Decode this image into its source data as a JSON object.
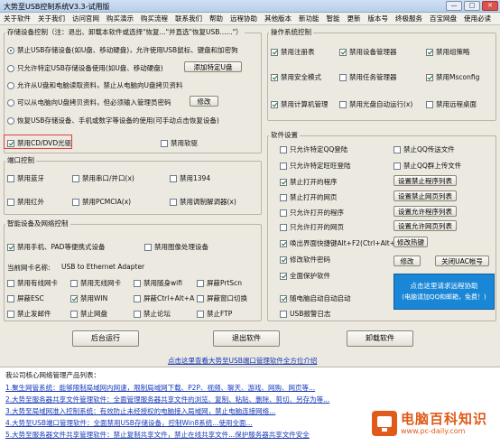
{
  "window": {
    "title": "大势至USB控制系统V3.3-试用版",
    "btn_min": "—",
    "btn_max": "□",
    "btn_close": "✕"
  },
  "menu": [
    "关于软件",
    "关于我们",
    "访问官网",
    "购买演示",
    "购买流程",
    "联系我们",
    "帮助",
    "远程协助",
    "其他版本",
    "新功能",
    "智能",
    "更新",
    "版本号",
    "终极服务",
    "百宝网盘",
    "使用必读"
  ],
  "storage": {
    "legend": "存储设备控制（注：退出、卸载本软件或选择\"恢复...\"并直选\"恢复USB......\"）",
    "options": [
      {
        "label": "禁止USB存储设备(如U盘、移动硬盘)，允许使用USB鼠标、键盘和加密狗",
        "checked": true
      },
      {
        "label": "只允许特定USB存储设备使用(如U盘、移动硬盘)",
        "checked": false
      },
      {
        "label": "允许从U盘和电脑读取资料，禁止从电脑向U盘拷贝资料",
        "checked": false
      },
      {
        "label": "可以从电脑向U盘拷贝资料，但必须输入管理员密码",
        "checked": false
      },
      {
        "label": "恢复USB存储设备、手机或数字等设备的使用(可手动点击恢复设备)",
        "checked": false
      }
    ],
    "add_usb_btn": "添加特定U盘",
    "modify_btn": "修改",
    "cd_label": "禁用CD/DVD光驱",
    "floppy_label": "禁用软驱"
  },
  "port": {
    "legend": "端口控制",
    "items": [
      "禁用蓝牙",
      "禁用串口/并口(x)",
      "禁用1394",
      "禁用红外",
      "禁用PCMCIA(x)",
      "禁用调制解调器(x)"
    ]
  },
  "smart": {
    "legend": "智能设备及网络控制",
    "items": [
      {
        "label": "禁用手机、PAD等便携式设备",
        "checked": true
      },
      {
        "label": "禁用图像处理设备",
        "checked": false
      }
    ],
    "netcard_label": "当前网卡名称:",
    "netcard_value": "USB to Ethernet Adapter",
    "net_items": [
      {
        "label": "禁用有线网卡",
        "checked": false
      },
      {
        "label": "禁用无线网卡",
        "checked": false
      },
      {
        "label": "禁用随身wifi",
        "checked": false
      },
      {
        "label": "屏蔽PrtScn",
        "checked": false
      },
      {
        "label": "屏蔽ESC",
        "checked": false
      },
      {
        "label": "禁用WIN",
        "checked": true
      },
      {
        "label": "屏蔽Ctrl+Alt+A",
        "checked": false
      },
      {
        "label": "屏蔽窗口切换",
        "checked": false
      },
      {
        "label": "禁止发邮件",
        "checked": false
      },
      {
        "label": "禁止网盘",
        "checked": false
      },
      {
        "label": "禁止论坛",
        "checked": false
      },
      {
        "label": "禁止FTP",
        "checked": false
      }
    ]
  },
  "os": {
    "legend": "操作系统控制",
    "items": [
      {
        "label": "禁用注册表",
        "checked": true
      },
      {
        "label": "禁用设备管理器",
        "checked": true
      },
      {
        "label": "禁用组策略",
        "checked": true
      },
      {
        "label": "禁用安全模式",
        "checked": true
      },
      {
        "label": "禁用任务管理器",
        "checked": false
      },
      {
        "label": "禁用Msconfig",
        "checked": true
      },
      {
        "label": "禁用计算机管理",
        "checked": true
      },
      {
        "label": "禁用光盘自动运行(x)",
        "checked": false
      },
      {
        "label": "禁用远程桌面",
        "checked": false
      }
    ]
  },
  "soft": {
    "legend": "软件设置",
    "left": [
      {
        "label": "只允许特定QQ登陆",
        "checked": false
      },
      {
        "label": "只允许特定旺旺登陆",
        "checked": false
      },
      {
        "label": "禁止打开的程序",
        "checked": true
      },
      {
        "label": "禁止打开的网页",
        "checked": false
      },
      {
        "label": "只允许打开的程序",
        "checked": false
      },
      {
        "label": "只允许打开的网页",
        "checked": false
      },
      {
        "label": "唤出界面快捷键Alt+F2(Ctrl+Alt+)",
        "checked": true
      },
      {
        "label": "修改软件密码",
        "checked": true
      },
      {
        "label": "全面保护软件",
        "checked": true
      },
      {
        "label": "随电脑启动自动启动",
        "checked": true
      },
      {
        "label": "USB报警日志",
        "checked": false
      }
    ],
    "right_checks": [
      {
        "label": "禁止QQ传送文件",
        "checked": false
      },
      {
        "label": "禁止QQ群上传文件",
        "checked": false
      }
    ],
    "right_btns": [
      "设置禁止程序列表",
      "设置禁止网页列表",
      "设置允许程序列表",
      "设置允许网页列表",
      "修改热键",
      "修改",
      "关闭UAC帐号"
    ],
    "promo_l1": "点击这里请求远程协助",
    "promo_l2": "(电脑请加QQ和邮箱，免费！)"
  },
  "actions": {
    "run_bg": "后台运行",
    "exit": "退出软件",
    "uninstall": "卸载软件"
  },
  "center_link": "点击这里查看大势至USB端口管理软件全方位介绍",
  "products": {
    "heading": "我公司核心网络管理产品列表：",
    "lines": [
      "1.聚生网管系统：能够限制局域网内网速，限制局域网下载、P2P、视频、聊天、游戏、网购、网页等...",
      "2.大势至服务器共享文件管理软件：全面管理服务器共享文件的浏览、复制、粘贴、删除、剪切、另存为等...",
      "3.大势至局域网准入控制系统：有效防止未经授权的电脑接入局域网，禁止电脑连接网络...",
      "4.大势至USB端口管理软件：全面禁用USB存储设备，控制Win8系统...使用全面...",
      "5.大势至服务器文件共享管理软件：禁止复制共享文件，禁止在线共享文件...保护服务器共享文件安全"
    ]
  },
  "watermark": {
    "title": "电脑百科知识",
    "url": "www.pc-daily.com"
  },
  "colors": {
    "accent": "#1a86d6",
    "link": "#1638b8",
    "highlight": "#e04040",
    "watermark": "#e05a1a"
  },
  "icons": {
    "close": "close-icon",
    "minimize": "minimize-icon",
    "maximize": "maximize-icon"
  }
}
